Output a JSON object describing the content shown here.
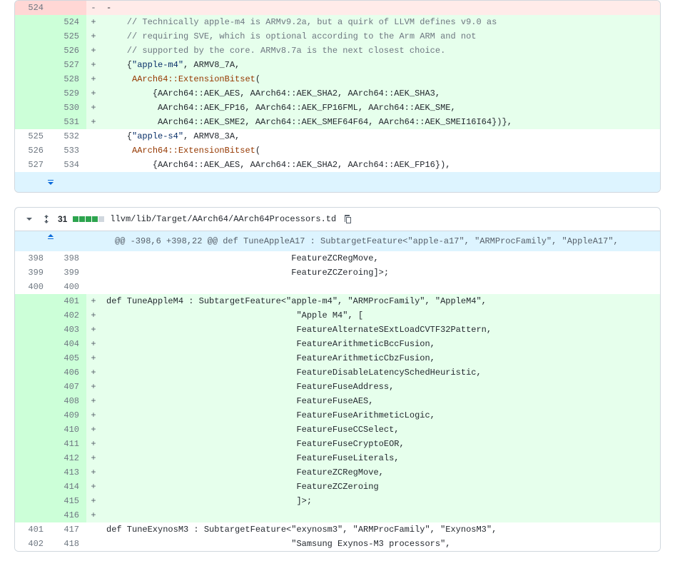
{
  "file1": {
    "rows": [
      {
        "old": "524",
        "new": "",
        "type": "del",
        "code": "-"
      },
      {
        "old": "",
        "new": "524",
        "type": "add",
        "code": "    // Technically apple-m4 is ARMv9.2a, but a quirk of LLVM defines v9.0 as",
        "cls": "cmt"
      },
      {
        "old": "",
        "new": "525",
        "type": "add",
        "code": "    // requiring SVE, which is optional according to the Arm ARM and not",
        "cls": "cmt"
      },
      {
        "old": "",
        "new": "526",
        "type": "add",
        "code": "    // supported by the core. ARMv8.7a is the next closest choice.",
        "cls": "cmt"
      },
      {
        "old": "",
        "new": "527",
        "type": "add",
        "code": "    {\"apple-m4\", ARMV8_7A,",
        "parts": [
          {
            "t": "    {"
          },
          {
            "t": "\"apple-m4\"",
            "c": "str"
          },
          {
            "t": ", ARMV8_7A,"
          }
        ]
      },
      {
        "old": "",
        "new": "528",
        "type": "add",
        "code": "     AArch64::ExtensionBitset(",
        "parts": [
          {
            "t": "     "
          },
          {
            "t": "AArch64::ExtensionBitset",
            "c": "cls"
          },
          {
            "t": "("
          }
        ]
      },
      {
        "old": "",
        "new": "529",
        "type": "add",
        "code": "         {AArch64::AEK_AES, AArch64::AEK_SHA2, AArch64::AEK_SHA3,"
      },
      {
        "old": "",
        "new": "530",
        "type": "add",
        "code": "          AArch64::AEK_FP16, AArch64::AEK_FP16FML, AArch64::AEK_SME,"
      },
      {
        "old": "",
        "new": "531",
        "type": "add",
        "code": "          AArch64::AEK_SME2, AArch64::AEK_SMEF64F64, AArch64::AEK_SMEI16I64})},"
      },
      {
        "old": "525",
        "new": "532",
        "type": "ctx",
        "code": "    {\"apple-s4\", ARMV8_3A,",
        "parts": [
          {
            "t": "    {"
          },
          {
            "t": "\"apple-s4\"",
            "c": "str"
          },
          {
            "t": ", ARMV8_3A,"
          }
        ]
      },
      {
        "old": "526",
        "new": "533",
        "type": "ctx",
        "code": "     AArch64::ExtensionBitset(",
        "parts": [
          {
            "t": "     "
          },
          {
            "t": "AArch64::ExtensionBitset",
            "c": "cls"
          },
          {
            "t": "("
          }
        ]
      },
      {
        "old": "527",
        "new": "534",
        "type": "ctx",
        "code": "         {AArch64::AEK_AES, AArch64::AEK_SHA2, AArch64::AEK_FP16}),"
      }
    ]
  },
  "file2": {
    "lineCount": "31",
    "path": "llvm/lib/Target/AArch64/AArch64Processors.td",
    "hunk": "@@ -398,6 +398,22 @@ def TuneAppleA17 : SubtargetFeature<\"apple-a17\", \"ARMProcFamily\", \"AppleA17\",",
    "rows": [
      {
        "old": "398",
        "new": "398",
        "type": "ctx",
        "code": "                                    FeatureZCRegMove,"
      },
      {
        "old": "399",
        "new": "399",
        "type": "ctx",
        "code": "                                    FeatureZCZeroing]>;"
      },
      {
        "old": "400",
        "new": "400",
        "type": "ctx",
        "code": ""
      },
      {
        "old": "",
        "new": "401",
        "type": "add",
        "code": "def TuneAppleM4 : SubtargetFeature<\"apple-m4\", \"ARMProcFamily\", \"AppleM4\","
      },
      {
        "old": "",
        "new": "402",
        "type": "add",
        "code": "                                     \"Apple M4\", ["
      },
      {
        "old": "",
        "new": "403",
        "type": "add",
        "code": "                                     FeatureAlternateSExtLoadCVTF32Pattern,"
      },
      {
        "old": "",
        "new": "404",
        "type": "add",
        "code": "                                     FeatureArithmeticBccFusion,"
      },
      {
        "old": "",
        "new": "405",
        "type": "add",
        "code": "                                     FeatureArithmeticCbzFusion,"
      },
      {
        "old": "",
        "new": "406",
        "type": "add",
        "code": "                                     FeatureDisableLatencySchedHeuristic,"
      },
      {
        "old": "",
        "new": "407",
        "type": "add",
        "code": "                                     FeatureFuseAddress,"
      },
      {
        "old": "",
        "new": "408",
        "type": "add",
        "code": "                                     FeatureFuseAES,"
      },
      {
        "old": "",
        "new": "409",
        "type": "add",
        "code": "                                     FeatureFuseArithmeticLogic,"
      },
      {
        "old": "",
        "new": "410",
        "type": "add",
        "code": "                                     FeatureFuseCCSelect,"
      },
      {
        "old": "",
        "new": "411",
        "type": "add",
        "code": "                                     FeatureFuseCryptoEOR,"
      },
      {
        "old": "",
        "new": "412",
        "type": "add",
        "code": "                                     FeatureFuseLiterals,"
      },
      {
        "old": "",
        "new": "413",
        "type": "add",
        "code": "                                     FeatureZCRegMove,"
      },
      {
        "old": "",
        "new": "414",
        "type": "add",
        "code": "                                     FeatureZCZeroing"
      },
      {
        "old": "",
        "new": "415",
        "type": "add",
        "code": "                                     ]>;"
      },
      {
        "old": "",
        "new": "416",
        "type": "add",
        "code": ""
      },
      {
        "old": "401",
        "new": "417",
        "type": "ctx",
        "code": "def TuneExynosM3 : SubtargetFeature<\"exynosm3\", \"ARMProcFamily\", \"ExynosM3\","
      },
      {
        "old": "402",
        "new": "418",
        "type": "ctx",
        "code": "                                    \"Samsung Exynos-M3 processors\","
      }
    ]
  }
}
